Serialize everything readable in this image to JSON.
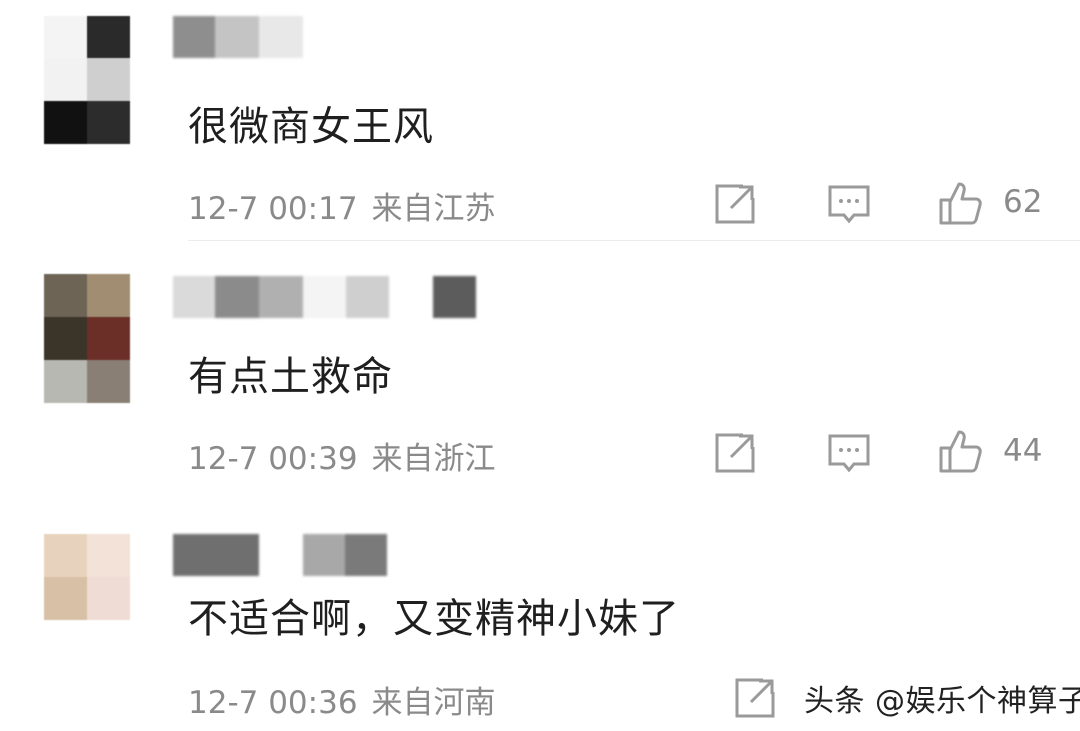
{
  "comments": [
    {
      "text": "很微商女王风",
      "time": "12-7 00:17",
      "location": "来自江苏",
      "likes": "62",
      "avatar_colors": [
        "#f4f4f4",
        "#2a2a2a",
        "#6e6e6e",
        "#cfcfcf",
        "#111111",
        "#2c2c2c"
      ],
      "name_colors": [
        "#8e8e8e",
        "#c4c4c4",
        "#e8e8e8"
      ]
    },
    {
      "text": "有点土救命",
      "time": "12-7 00:39",
      "location": "来自浙江",
      "likes": "44",
      "avatar_colors": [
        "#6d6455",
        "#a08d72",
        "#3a3528",
        "#6b2f28",
        "#b8b8b2",
        "#8a7f74"
      ],
      "name_colors": [
        "#dadada",
        "#8b8b8b",
        "#b0b0b0",
        "#f0f0f0",
        "#cfcfcf",
        "#ffffff",
        "#5c5c5c"
      ]
    },
    {
      "text": "不适合啊，又变精神小妹了",
      "time": "12-7 00:36",
      "location": "来自河南",
      "avatar_colors": [
        "#e7d3bd",
        "#f2e2d8",
        "#d8c0a6",
        "#efdcd4"
      ],
      "name_colors": [
        "#6f6f6f",
        "#a8a8a8",
        "#7a7a7a"
      ]
    }
  ],
  "watermark": "头条 @娱乐个神算子",
  "icons": {
    "share": "share-icon",
    "reply": "comment-icon",
    "like": "thumbs-up-icon"
  }
}
